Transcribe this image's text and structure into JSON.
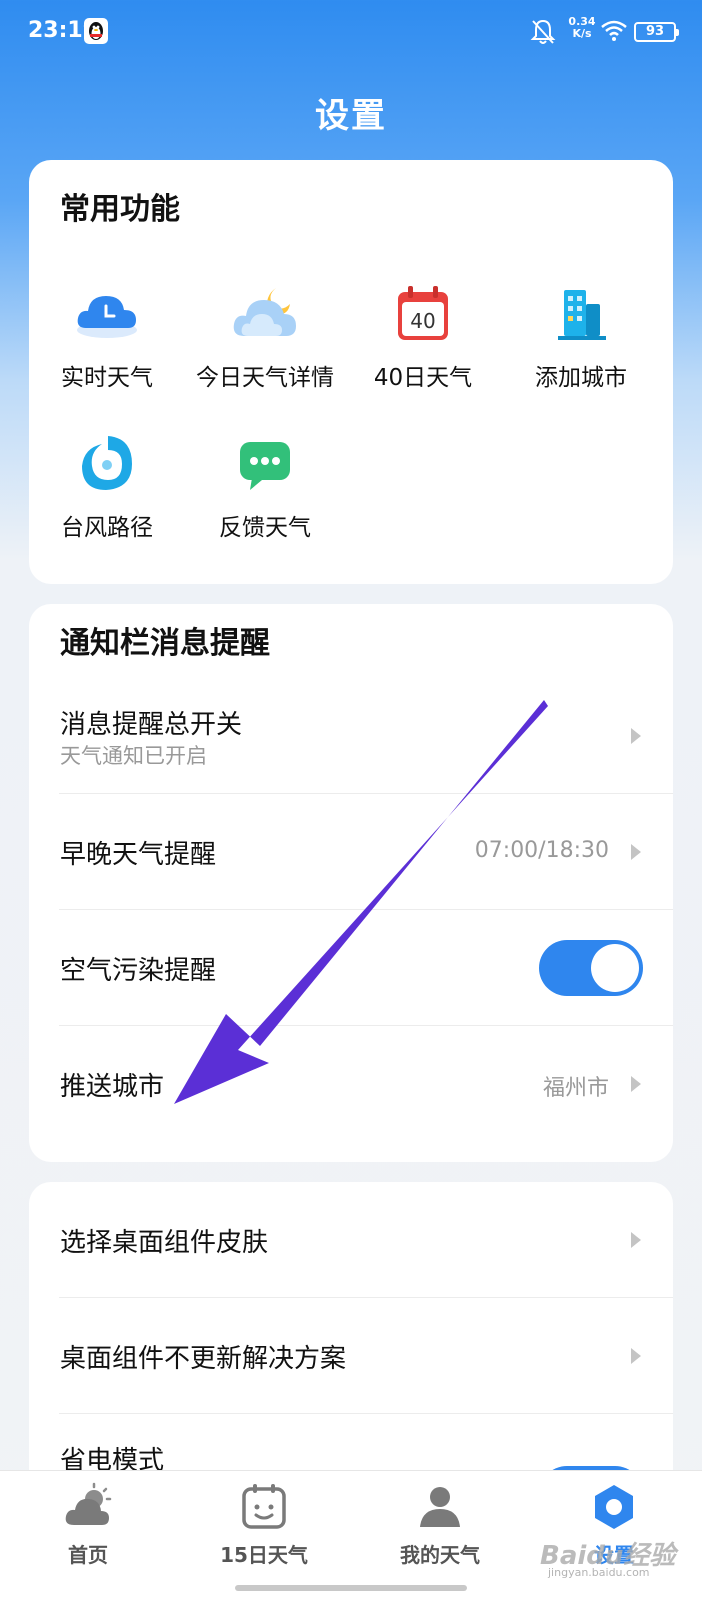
{
  "status_bar": {
    "time": "23:19",
    "net_speed_value": "0.34",
    "net_speed_unit": "K/s",
    "battery": "93"
  },
  "header": {
    "title": "设置"
  },
  "common_features": {
    "title": "常用功能",
    "items": [
      {
        "label": "实时天气",
        "icon": "cloud-clock-icon"
      },
      {
        "label": "今日天气详情",
        "icon": "cloud-moon-icon"
      },
      {
        "label": "40日天气",
        "icon": "calendar-40-icon"
      },
      {
        "label": "添加城市",
        "icon": "city-buildings-icon"
      },
      {
        "label": "台风路径",
        "icon": "typhoon-icon"
      },
      {
        "label": "反馈天气",
        "icon": "chat-bubble-icon"
      }
    ]
  },
  "notifications": {
    "title": "通知栏消息提醒",
    "rows": [
      {
        "label": "消息提醒总开关",
        "sub": "天气通知已开启"
      },
      {
        "label": "早晚天气提醒",
        "value": "07:00/18:30"
      },
      {
        "label": "空气污染提醒",
        "toggle_on": true
      },
      {
        "label": "推送城市",
        "value": "福州市"
      }
    ]
  },
  "widget": {
    "rows": [
      {
        "label": "选择桌面组件皮肤"
      },
      {
        "label": "桌面组件不更新解决方案"
      },
      {
        "label": "省电模式"
      }
    ]
  },
  "tabs": [
    {
      "label": "首页",
      "icon": "cloud-sun-icon",
      "active": false
    },
    {
      "label": "15日天气",
      "icon": "calendar-face-icon",
      "active": false
    },
    {
      "label": "我的天气",
      "icon": "person-icon",
      "active": false
    },
    {
      "label": "设置",
      "icon": "hexagon-settings-icon",
      "active": true
    }
  ],
  "watermark": {
    "text": "Baidu经验",
    "sub": "jingyan.baidu.com"
  },
  "colors": {
    "accent": "#2f86ee",
    "arrow": "#5b2fd6",
    "header_bg": "#2f8cf0"
  }
}
